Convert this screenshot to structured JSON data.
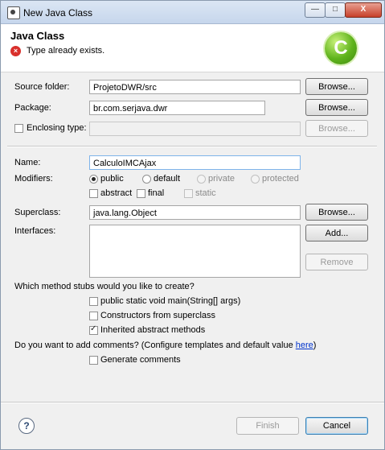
{
  "window": {
    "title": "New Java Class",
    "buttons": {
      "minimize": "—",
      "maximize": "□",
      "close": "X"
    }
  },
  "header": {
    "title": "Java Class",
    "error_icon": "error-icon",
    "message": "Type already exists.",
    "logo_letter": "C"
  },
  "form": {
    "source_folder": {
      "label": "Source folder:",
      "value": "ProjetoDWR/src",
      "button": "Browse..."
    },
    "package": {
      "label": "Package:",
      "value": "br.com.serjava.dwr",
      "button": "Browse..."
    },
    "enclosing_type": {
      "label": "Enclosing type:",
      "checked": false,
      "value": "",
      "button": "Browse..."
    },
    "name": {
      "label": "Name:",
      "value": "CalculoIMCAjax"
    },
    "modifiers": {
      "label": "Modifiers:",
      "radios": [
        {
          "label": "public",
          "checked": true,
          "enabled": true
        },
        {
          "label": "default",
          "checked": false,
          "enabled": true
        },
        {
          "label": "private",
          "checked": false,
          "enabled": false
        },
        {
          "label": "protected",
          "checked": false,
          "enabled": false
        }
      ],
      "checkboxes": [
        {
          "label": "abstract",
          "checked": false,
          "enabled": true
        },
        {
          "label": "final",
          "checked": false,
          "enabled": true
        },
        {
          "label": "static",
          "checked": false,
          "enabled": false
        }
      ]
    },
    "superclass": {
      "label": "Superclass:",
      "value": "java.lang.Object",
      "button": "Browse..."
    },
    "interfaces": {
      "label": "Interfaces:",
      "add_button": "Add...",
      "remove_button": "Remove"
    },
    "stubs": {
      "question": "Which method stubs would you like to create?",
      "options": [
        {
          "label": "public static void main(String[] args)",
          "checked": false
        },
        {
          "label": "Constructors from superclass",
          "checked": false
        },
        {
          "label": "Inherited abstract methods",
          "checked": true
        }
      ]
    },
    "comments": {
      "question_prefix": "Do you want to add comments? (Configure templates and default value ",
      "link": "here",
      "question_suffix": ")",
      "option": {
        "label": "Generate comments",
        "checked": false
      }
    }
  },
  "footer": {
    "help_icon": "help-icon",
    "help_glyph": "?",
    "finish": "Finish",
    "cancel": "Cancel"
  }
}
